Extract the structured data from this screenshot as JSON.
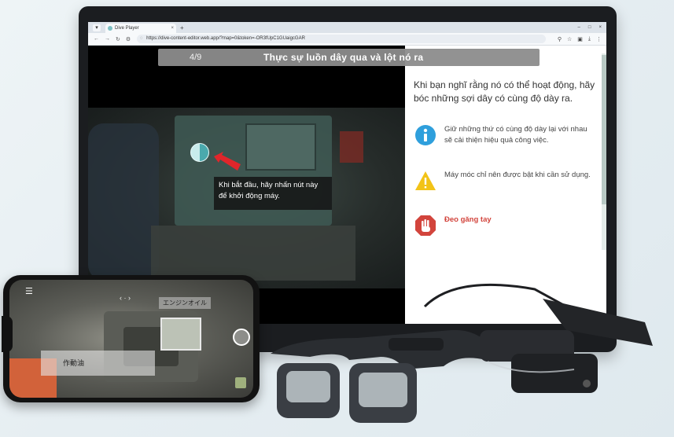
{
  "browser": {
    "tab_title": "Dive Player",
    "tab_close": "×",
    "new_tab": "+",
    "url": "https://dive-content-editor.web.app/?map=0&token=-OR3fUpC1GUaigcGAR",
    "window_controls": [
      "–",
      "□",
      "×"
    ]
  },
  "slide": {
    "page_indicator": "4/9",
    "title": "Thực sự luồn dây qua và lột nó ra",
    "callout": "Khi bắt đầu, hãy nhấn nút này để khởi động máy."
  },
  "panel": {
    "lead": "Khi bạn nghĩ rằng nó có thể hoạt động, hãy bóc những sợi dây có cùng độ dày ra.",
    "items": [
      {
        "icon": "info-icon",
        "text": "Giữ những thứ có cùng độ dày lại với nhau sẽ cải thiện hiệu quả công việc.",
        "color": "#2f9fdc"
      },
      {
        "icon": "warning-icon",
        "text": "Máy móc chỉ nên được bật khi cần sử dụng.",
        "color": "#f2c318"
      },
      {
        "icon": "stop-hand-icon",
        "text": "Đeo găng tay",
        "color": "#d2443c"
      }
    ]
  },
  "phone": {
    "menu": "☰",
    "nav_arrows": "‹  ·  ›",
    "label_top": "エンジンオイル",
    "label_oil": "作動油"
  },
  "colors": {
    "accent": "#4aa9ad",
    "stop": "#d2443c",
    "warning": "#f2c318",
    "info": "#2f9fdc"
  }
}
